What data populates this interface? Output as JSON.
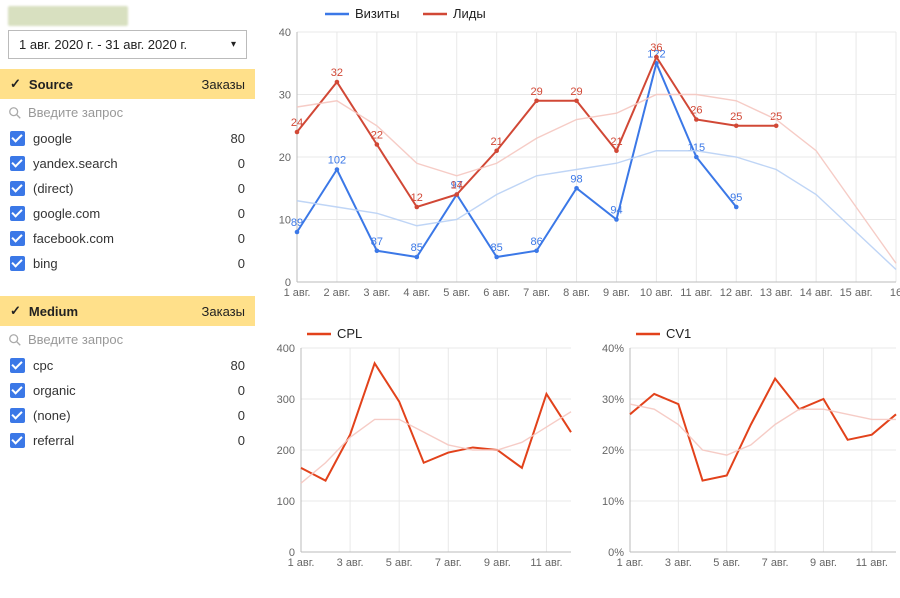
{
  "date_range": {
    "text": "1 авг. 2020 г. - 31 авг. 2020 г."
  },
  "panels": {
    "source": {
      "title": "Source",
      "metric_label": "Заказы",
      "search_placeholder": "Введите запрос",
      "items": [
        {
          "label": "google",
          "value": "80"
        },
        {
          "label": "yandex.search",
          "value": "0"
        },
        {
          "label": "(direct)",
          "value": "0"
        },
        {
          "label": "google.com",
          "value": "0"
        },
        {
          "label": "facebook.com",
          "value": "0"
        },
        {
          "label": "bing",
          "value": "0"
        }
      ]
    },
    "medium": {
      "title": "Medium",
      "metric_label": "Заказы",
      "search_placeholder": "Введите запрос",
      "items": [
        {
          "label": "cpc",
          "value": "80"
        },
        {
          "label": "organic",
          "value": "0"
        },
        {
          "label": "(none)",
          "value": "0"
        },
        {
          "label": "referral",
          "value": "0"
        }
      ]
    }
  },
  "colors": {
    "visits": "#3b78e7",
    "leads": "#d14836",
    "cpl": "#e2421b",
    "cv1": "#e2421b",
    "grid": "#e8e8e8",
    "axis": "#999",
    "faded_blue": "#b8d0f5",
    "faded_red": "#f5c6c0"
  },
  "chart_data": [
    {
      "id": "main",
      "type": "line",
      "title": "",
      "x_categories": [
        "1 авг.",
        "2 авг.",
        "3 авг.",
        "4 авг.",
        "5 авг.",
        "6 авг.",
        "7 авг.",
        "8 авг.",
        "9 авг.",
        "10 авг.",
        "11 авг.",
        "12 авг.",
        "13 авг.",
        "14 авг.",
        "15 авг.",
        "16"
      ],
      "y_ticks": [
        0,
        10,
        20,
        30,
        40
      ],
      "ylim": [
        0,
        40
      ],
      "legend": [
        {
          "name": "Визиты",
          "color": "#3b78e7"
        },
        {
          "name": "Лиды",
          "color": "#d14836"
        }
      ],
      "series": [
        {
          "name": "Визиты",
          "color": "#3b78e7",
          "values": [
            89,
            102,
            87,
            85,
            97,
            85,
            86,
            98,
            94,
            122,
            115,
            95,
            null,
            null,
            null,
            null
          ],
          "labels": [
            "89",
            "102",
            "87",
            "85",
            "97",
            "85",
            "86",
            "98",
            "94",
            "122",
            "115",
            "95",
            "",
            "",
            "",
            ""
          ],
          "plot_y": [
            8,
            18,
            5,
            4,
            14,
            4,
            5,
            15,
            10,
            35,
            20,
            12,
            null,
            null,
            null,
            null
          ]
        },
        {
          "name": "Лиды",
          "color": "#d14836",
          "values": [
            24,
            32,
            22,
            12,
            14,
            21,
            29,
            29,
            21,
            36,
            26,
            25,
            25,
            null,
            null,
            null
          ],
          "labels": [
            "24",
            "32",
            "22",
            "12",
            "14",
            "21",
            "29",
            "29",
            "21",
            "36",
            "26",
            "25",
            "25",
            "",
            "",
            ""
          ],
          "plot_y": [
            24,
            32,
            22,
            12,
            14,
            21,
            29,
            29,
            21,
            36,
            26,
            25,
            25,
            null,
            null,
            null
          ]
        },
        {
          "name": "Визиты-faded",
          "color": "#b8d0f5",
          "faded": true,
          "plot_y": [
            13,
            12,
            11,
            9,
            10,
            14,
            17,
            18,
            19,
            21,
            21,
            20,
            18,
            14,
            8,
            2
          ]
        },
        {
          "name": "Лиды-faded",
          "color": "#f5c6c0",
          "faded": true,
          "plot_y": [
            28,
            29,
            25,
            19,
            17,
            19,
            23,
            26,
            27,
            30,
            30,
            29,
            26,
            21,
            12,
            3
          ]
        }
      ]
    },
    {
      "id": "cpl",
      "type": "line",
      "legend": [
        {
          "name": "CPL",
          "color": "#e2421b"
        }
      ],
      "x_categories": [
        "1 авг.",
        "3 авг.",
        "5 авг.",
        "7 авг.",
        "9 авг.",
        "11 авг."
      ],
      "y_ticks": [
        0,
        100,
        200,
        300,
        400
      ],
      "ylim": [
        0,
        400
      ],
      "series": [
        {
          "name": "CPL",
          "color": "#e2421b",
          "values": [
            165,
            140,
            230,
            370,
            295,
            175,
            195,
            205,
            200,
            165,
            310,
            235
          ],
          "plot_y": [
            165,
            140,
            230,
            370,
            295,
            175,
            195,
            205,
            200,
            165,
            310,
            235
          ]
        },
        {
          "name": "CPL-faded",
          "color": "#f5c6c0",
          "faded": true,
          "plot_y": [
            135,
            175,
            225,
            260,
            260,
            235,
            210,
            200,
            200,
            215,
            245,
            275
          ]
        }
      ]
    },
    {
      "id": "cv1",
      "type": "line",
      "legend": [
        {
          "name": "CV1",
          "color": "#e2421b"
        }
      ],
      "x_categories": [
        "1 авг.",
        "3 авг.",
        "5 авг.",
        "7 авг.",
        "9 авг.",
        "11 авг."
      ],
      "y_ticks_labels": [
        "0%",
        "10%",
        "20%",
        "30%",
        "40%"
      ],
      "y_ticks": [
        0,
        10,
        20,
        30,
        40
      ],
      "ylim": [
        0,
        40
      ],
      "series": [
        {
          "name": "CV1",
          "color": "#e2421b",
          "values": [
            27,
            31,
            29,
            14,
            15,
            25,
            34,
            28,
            30,
            22,
            23,
            27
          ],
          "plot_y": [
            27,
            31,
            29,
            14,
            15,
            25,
            34,
            28,
            30,
            22,
            23,
            27
          ]
        },
        {
          "name": "CV1-faded",
          "color": "#f5c6c0",
          "faded": true,
          "plot_y": [
            29,
            28,
            25,
            20,
            19,
            21,
            25,
            28,
            28,
            27,
            26,
            26
          ]
        }
      ]
    }
  ]
}
